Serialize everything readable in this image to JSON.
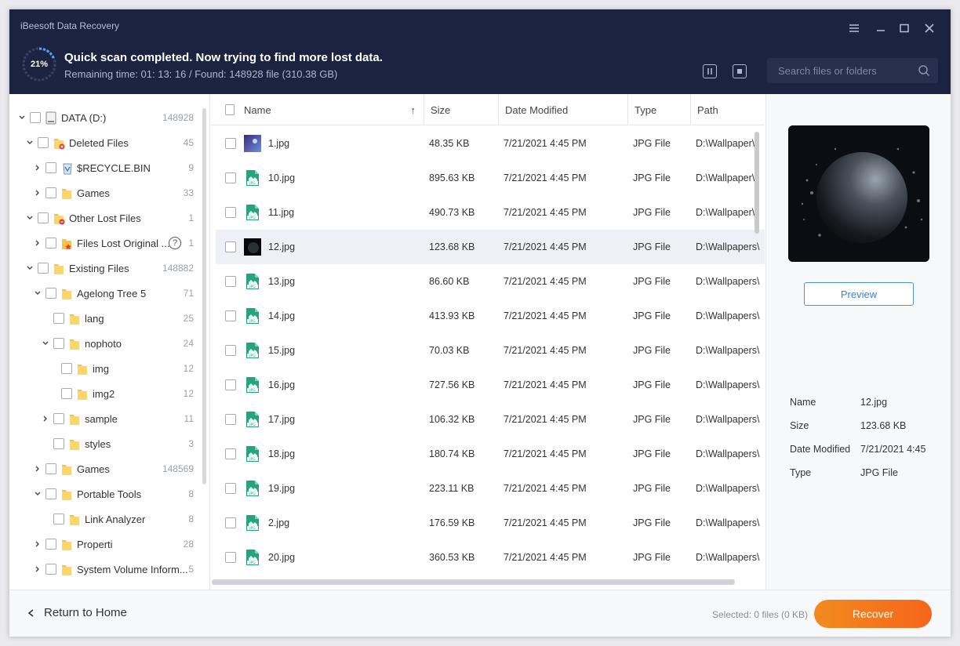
{
  "app": {
    "title": "iBeesoft Data Recovery"
  },
  "scan": {
    "percent": "21%",
    "title": "Quick scan completed. Now trying to find more lost data.",
    "subtitle": "Remaining time: 01: 13: 16 / Found: 148928 file (310.38 GB)"
  },
  "search": {
    "placeholder": "Search files or folders"
  },
  "tree": [
    {
      "label": "DATA (D:)",
      "count": "148928",
      "indent": 0,
      "chev": "open",
      "icon": "drive-icon"
    },
    {
      "label": "Deleted Files",
      "count": "45",
      "indent": 1,
      "chev": "open",
      "icon": "folder-deleted-icon"
    },
    {
      "label": "$RECYCLE.BIN",
      "count": "9",
      "indent": 2,
      "chev": "closed",
      "icon": "recycle-bin-icon"
    },
    {
      "label": "Games",
      "count": "33",
      "indent": 2,
      "chev": "closed",
      "icon": "folder-icon"
    },
    {
      "label": "Other Lost Files",
      "count": "1",
      "indent": 1,
      "chev": "open",
      "icon": "folder-lost-icon"
    },
    {
      "label": "Files Lost Original ...",
      "count": "1",
      "indent": 2,
      "chev": "closed",
      "icon": "file-star-icon",
      "help": true
    },
    {
      "label": "Existing Files",
      "count": "148882",
      "indent": 1,
      "chev": "open",
      "icon": "folder-icon"
    },
    {
      "label": "Agelong Tree 5",
      "count": "71",
      "indent": 2,
      "chev": "open",
      "icon": "folder-icon"
    },
    {
      "label": "lang",
      "count": "25",
      "indent": 3,
      "chev": "none",
      "icon": "folder-icon"
    },
    {
      "label": "nophoto",
      "count": "24",
      "indent": 3,
      "chev": "open",
      "icon": "folder-icon"
    },
    {
      "label": "img",
      "count": "12",
      "indent": 4,
      "chev": "none",
      "icon": "folder-icon"
    },
    {
      "label": "img2",
      "count": "12",
      "indent": 4,
      "chev": "none",
      "icon": "folder-icon"
    },
    {
      "label": "sample",
      "count": "11",
      "indent": 3,
      "chev": "closed",
      "icon": "folder-icon"
    },
    {
      "label": "styles",
      "count": "3",
      "indent": 3,
      "chev": "none",
      "icon": "folder-icon"
    },
    {
      "label": "Games",
      "count": "148569",
      "indent": 2,
      "chev": "closed",
      "icon": "folder-icon"
    },
    {
      "label": "Portable Tools",
      "count": "8",
      "indent": 2,
      "chev": "open",
      "icon": "folder-icon"
    },
    {
      "label": "Link Analyzer",
      "count": "8",
      "indent": 3,
      "chev": "none",
      "icon": "folder-icon"
    },
    {
      "label": "Properti",
      "count": "28",
      "indent": 2,
      "chev": "closed",
      "icon": "folder-icon"
    },
    {
      "label": "System Volume Inform...",
      "count": "5",
      "indent": 2,
      "chev": "closed",
      "icon": "folder-icon"
    }
  ],
  "columns": {
    "name": "Name",
    "size": "Size",
    "date": "Date Modified",
    "type": "Type",
    "path": "Path"
  },
  "files": [
    {
      "name": "1.jpg",
      "size": "48.35 KB",
      "date": "7/21/2021 4:45 PM",
      "type": "JPG File",
      "path": "D:\\Wallpaper\\",
      "thumb": "image"
    },
    {
      "name": "10.jpg",
      "size": "895.63 KB",
      "date": "7/21/2021 4:45 PM",
      "type": "JPG File",
      "path": "D:\\Wallpaper\\",
      "thumb": "jpg"
    },
    {
      "name": "11.jpg",
      "size": "490.73 KB",
      "date": "7/21/2021 4:45 PM",
      "type": "JPG File",
      "path": "D:\\Wallpaper\\",
      "thumb": "jpg"
    },
    {
      "name": "12.jpg",
      "size": "123.68 KB",
      "date": "7/21/2021 4:45 PM",
      "type": "JPG File",
      "path": "D:\\Wallpapers\\",
      "thumb": "dark",
      "selected": true
    },
    {
      "name": "13.jpg",
      "size": "86.60 KB",
      "date": "7/21/2021 4:45 PM",
      "type": "JPG File",
      "path": "D:\\Wallpapers\\",
      "thumb": "jpg"
    },
    {
      "name": "14.jpg",
      "size": "413.93 KB",
      "date": "7/21/2021 4:45 PM",
      "type": "JPG File",
      "path": "D:\\Wallpapers\\",
      "thumb": "jpg"
    },
    {
      "name": "15.jpg",
      "size": "70.03 KB",
      "date": "7/21/2021 4:45 PM",
      "type": "JPG File",
      "path": "D:\\Wallpapers\\",
      "thumb": "jpg"
    },
    {
      "name": "16.jpg",
      "size": "727.56 KB",
      "date": "7/21/2021 4:45 PM",
      "type": "JPG File",
      "path": "D:\\Wallpapers\\",
      "thumb": "jpg"
    },
    {
      "name": "17.jpg",
      "size": "106.32 KB",
      "date": "7/21/2021 4:45 PM",
      "type": "JPG File",
      "path": "D:\\Wallpapers\\",
      "thumb": "jpg"
    },
    {
      "name": "18.jpg",
      "size": "180.74 KB",
      "date": "7/21/2021 4:45 PM",
      "type": "JPG File",
      "path": "D:\\Wallpapers\\",
      "thumb": "jpg"
    },
    {
      "name": "19.jpg",
      "size": "223.11 KB",
      "date": "7/21/2021 4:45 PM",
      "type": "JPG File",
      "path": "D:\\Wallpapers\\",
      "thumb": "jpg"
    },
    {
      "name": "2.jpg",
      "size": "176.59 KB",
      "date": "7/21/2021 4:45 PM",
      "type": "JPG File",
      "path": "D:\\Wallpapers\\",
      "thumb": "jpg"
    },
    {
      "name": "20.jpg",
      "size": "360.53 KB",
      "date": "7/21/2021 4:45 PM",
      "type": "JPG File",
      "path": "D:\\Wallpapers\\",
      "thumb": "jpg"
    }
  ],
  "preview": {
    "button": "Preview",
    "meta": [
      {
        "key": "Name",
        "value": "12.jpg"
      },
      {
        "key": "Size",
        "value": "123.68 KB"
      },
      {
        "key": "Date Modified",
        "value": "7/21/2021 4:45"
      },
      {
        "key": "Type",
        "value": "JPG File"
      }
    ]
  },
  "footer": {
    "back": "Return to Home",
    "selected": "Selected: 0 files (0 KB)",
    "recover": "Recover"
  },
  "colors": {
    "header_bg": "#1c2340",
    "accent_orange": "#f5651c",
    "preview_blue": "#3b7fd6"
  }
}
